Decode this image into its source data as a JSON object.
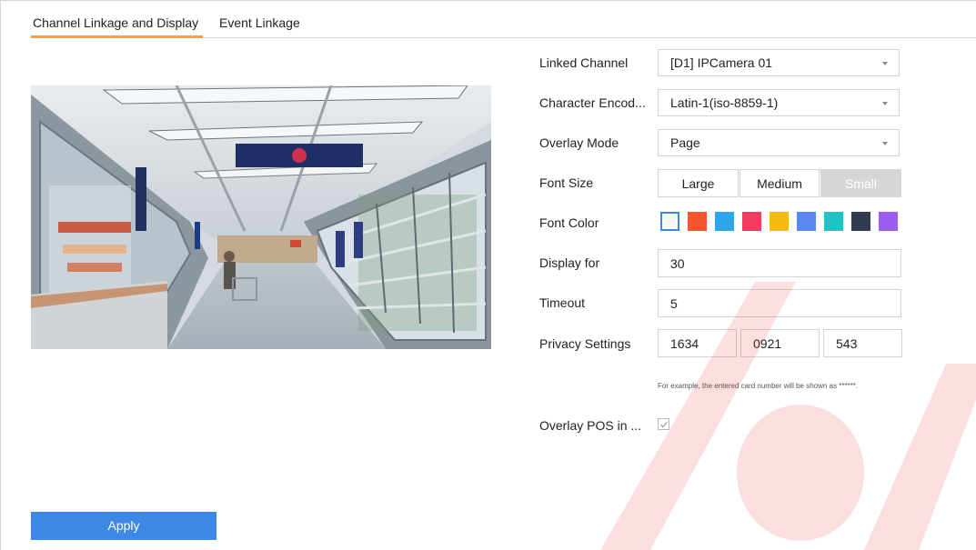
{
  "tabs": [
    {
      "label": "Channel Linkage and Display",
      "active": true
    },
    {
      "label": "Event Linkage",
      "active": false
    }
  ],
  "form": {
    "linked_channel": {
      "label": "Linked Channel",
      "value": "[D1] IPCamera 01"
    },
    "character_encoding": {
      "label": "Character Encod...",
      "value": "Latin-1(iso-8859-1)"
    },
    "overlay_mode": {
      "label": "Overlay Mode",
      "value": "Page"
    },
    "font_size": {
      "label": "Font Size",
      "options": [
        "Large",
        "Medium",
        "Small"
      ],
      "selected": "Small"
    },
    "font_color": {
      "label": "Font Color",
      "colors": [
        "#f7f7f7",
        "#f5562e",
        "#2ea6ec",
        "#f23e63",
        "#f6bb12",
        "#5a88ee",
        "#20c3c3",
        "#323a52",
        "#9b5ef3"
      ],
      "selected_index": 0
    },
    "display_for": {
      "label": "Display for",
      "value": "30"
    },
    "timeout": {
      "label": "Timeout",
      "value": "5"
    },
    "privacy_settings": {
      "label": "Privacy Settings",
      "values": [
        "1634",
        "0921",
        "543"
      ]
    },
    "privacy_hint": "For example, the entered card number will be shown as ******.",
    "overlay_pos": {
      "label": "Overlay POS in ...",
      "checked": true
    }
  },
  "apply_label": "Apply",
  "colors": {
    "accent": "#f0a04b",
    "primary_button": "#3d88e6",
    "watermark": "#e8262b"
  }
}
